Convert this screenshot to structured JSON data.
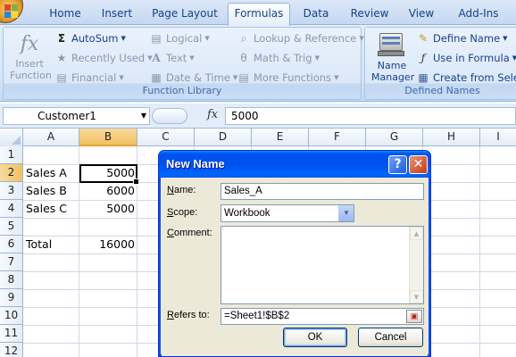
{
  "ribbon": {
    "tabs": [
      {
        "label": "Home"
      },
      {
        "label": "Insert"
      },
      {
        "label": "Page Layout"
      },
      {
        "label": "Formulas"
      },
      {
        "label": "Data"
      },
      {
        "label": "Review"
      },
      {
        "label": "View"
      },
      {
        "label": "Add-Ins"
      }
    ],
    "active_tab": "Formulas",
    "function_library": {
      "label": "Function Library",
      "insert_function": "Insert Function",
      "insert_function_icon": "fx",
      "autosum": "AutoSum",
      "autosum_icon": "Σ",
      "recently_used": "Recently Used",
      "financial": "Financial",
      "logical": "Logical",
      "text": "Text",
      "date_time": "Date & Time",
      "lookup": "Lookup & Reference",
      "math": "Math & Trig",
      "more": "More Functions"
    },
    "defined_names": {
      "label": "Defined Names",
      "name_manager": "Name Manager",
      "define_name": "Define Name",
      "use_in_formula": "Use in Formula",
      "create_from_selection": "Create from Select"
    }
  },
  "formula_bar": {
    "name_box": "Customer1",
    "fx": "fx",
    "value": "5000"
  },
  "grid": {
    "columns": [
      "A",
      "B",
      "C",
      "D",
      "E",
      "F",
      "G",
      "H",
      "I"
    ],
    "selected_column": "B",
    "rows": [
      "1",
      "2",
      "3",
      "4",
      "5",
      "6",
      "7",
      "8",
      "9",
      "10",
      "11",
      "12"
    ],
    "selected_row": "2",
    "cells": {
      "A2": "Sales A",
      "B2": "5000",
      "A3": "Sales B",
      "B3": "6000",
      "A4": "Sales C",
      "B4": "5000",
      "A6": "Total",
      "B6": "16000"
    }
  },
  "dialog": {
    "title": "New Name",
    "help": "?",
    "close": "✕",
    "name_label_u": "N",
    "name_label_rest": "ame:",
    "name_value": "Sales_A",
    "scope_label_u": "S",
    "scope_label_rest": "cope:",
    "scope_value": "Workbook",
    "comment_label_u": "C",
    "comment_label_rest": "omment:",
    "comment_value": "",
    "refers_label_u": "R",
    "refers_label_rest": "efers to:",
    "refers_value": "=Sheet1!$B$2",
    "ok": "OK",
    "cancel": "Cancel"
  }
}
